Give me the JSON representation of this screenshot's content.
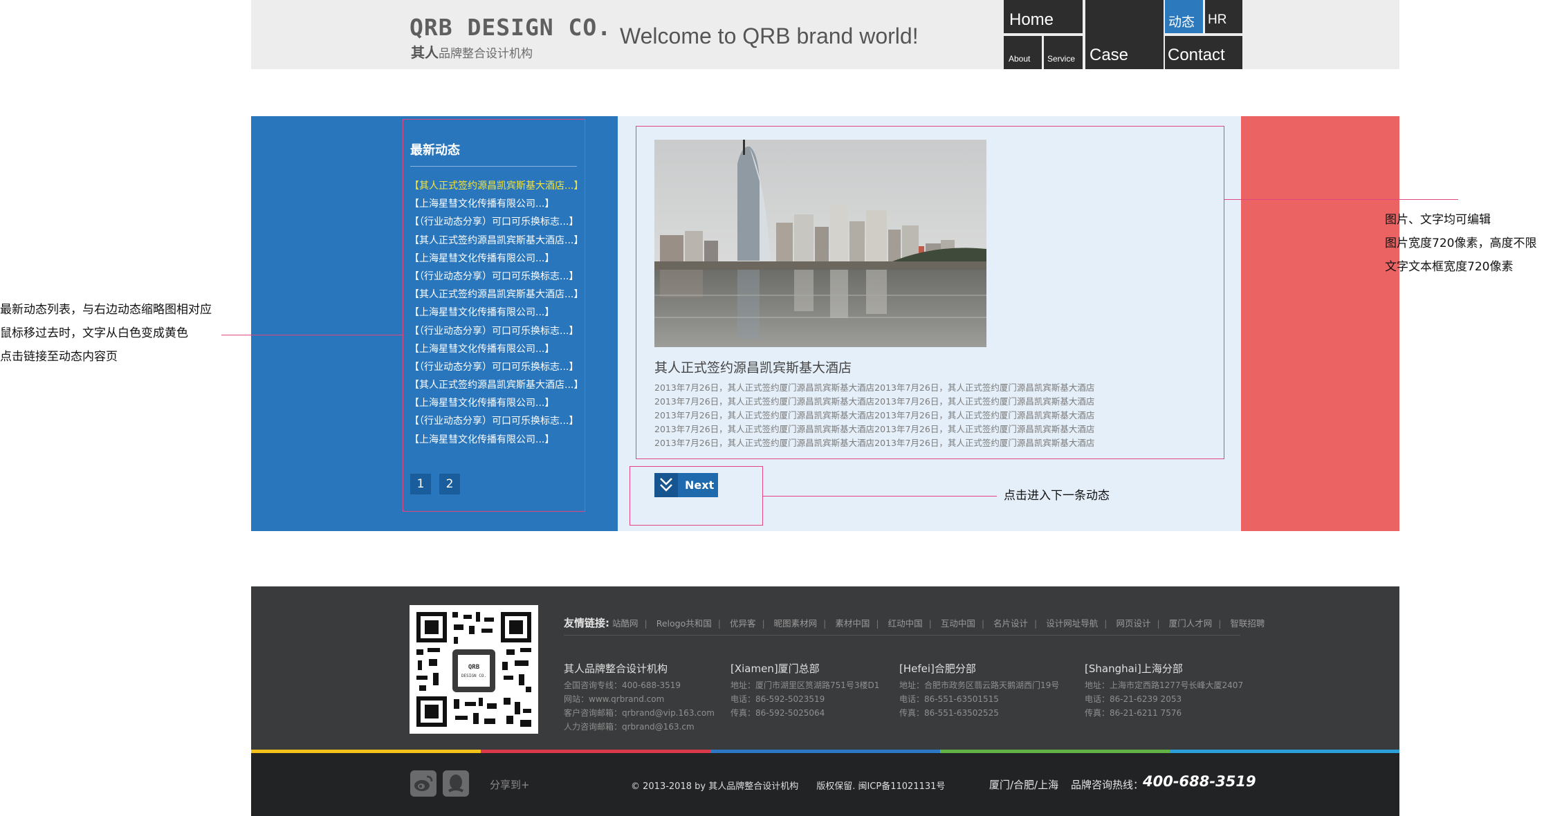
{
  "header": {
    "logo_title": "QRB DESIGN CO.",
    "logo_brand": "其人",
    "logo_sub": "品牌整合设计机构",
    "welcome": "Welcome to QRB brand world!",
    "nav": {
      "home": "Home",
      "about": "About",
      "service": "Service",
      "case": "Case",
      "news": "动态",
      "hr": "HR",
      "contact": "Contact"
    },
    "active_nav": "动态",
    "accent_color": "#2c79be"
  },
  "news_panel": {
    "title": "最新动态",
    "items": [
      "【其人正式签约源昌凯宾斯基大酒店...】",
      "【上海星彗文化传播有限公司...】",
      "【（行业动态分享）可口可乐换标志...】",
      "【其人正式签约源昌凯宾斯基大酒店...】",
      "【上海星彗文化传播有限公司...】",
      "【（行业动态分享）可口可乐换标志...】",
      "【其人正式签约源昌凯宾斯基大酒店...】",
      "【上海星彗文化传播有限公司...】",
      "【（行业动态分享）可口可乐换标志...】",
      "【上海星彗文化传播有限公司...】",
      "【（行业动态分享）可口可乐换标志...】",
      "【其人正式签约源昌凯宾斯基大酒店...】",
      "【上海星彗文化传播有限公司...】",
      "【（行业动态分享）可口可乐换标志...】",
      "【上海星彗文化传播有限公司...】"
    ],
    "highlight_color": "#f5e43c",
    "pages": [
      "1",
      "2"
    ]
  },
  "article": {
    "title": "其人正式签约源昌凯宾斯基大酒店",
    "lines": [
      "2013年7月26日，其人正式签约厦门源昌凯宾斯基大酒店2013年7月26日，其人正式签约厦门源昌凯宾斯基大酒店",
      "2013年7月26日，其人正式签约厦门源昌凯宾斯基大酒店2013年7月26日，其人正式签约厦门源昌凯宾斯基大酒店",
      "2013年7月26日，其人正式签约厦门源昌凯宾斯基大酒店2013年7月26日，其人正式签约厦门源昌凯宾斯基大酒店",
      "2013年7月26日，其人正式签约厦门源昌凯宾斯基大酒店2013年7月26日，其人正式签约厦门源昌凯宾斯基大酒店",
      "2013年7月26日，其人正式签约厦门源昌凯宾斯基大酒店2013年7月26日，其人正式签约厦门源昌凯宾斯基大酒店"
    ],
    "next_label": "Next"
  },
  "annotations": {
    "left": [
      "最新动态列表，与右边动态缩略图相对应",
      "鼠标移过去时，文字从白色变成黄色",
      "点击链接至动态内容页"
    ],
    "right": [
      "图片、文字均可编辑",
      "图片宽度720像素，高度不限",
      "文字文本框宽度720像素"
    ],
    "next": "点击进入下一条动态"
  },
  "footer": {
    "links_label": "友情链接:",
    "links": [
      "站酷网",
      "Relogo共和国",
      "优异客",
      "昵图素材网",
      "素材中国",
      "红动中国",
      "互动中国",
      "名片设计",
      "设计网址导航",
      "网页设计",
      "厦门人才网",
      "智联招聘"
    ],
    "offices": [
      {
        "name": "其人品牌整合设计机构",
        "lines": [
          "全国咨询专线：400-688-3519",
          "网站：www.qrbrand.com",
          "客户咨询邮箱：qrbrand@vip.163.com",
          "人力咨询邮箱：qrbrand@163.cm"
        ]
      },
      {
        "name": "[Xiamen]厦门总部",
        "lines": [
          "地址：厦门市湖里区筼湖路751号3楼D1",
          "电话：86-592-5023519",
          "传真：86-592-5025064"
        ]
      },
      {
        "name": "[Hefei]合肥分部",
        "lines": [
          "地址：合肥市政务区翡云路天鹅湖西门19号",
          "电话：86-551-63501515",
          "传真：86-551-63502525"
        ]
      },
      {
        "name": "[Shanghai]上海分部",
        "lines": [
          "地址：上海市定西路1277号长峰大厦2407",
          "电话：86-21-6239 2053",
          "传真：86-21-6211 7576"
        ]
      }
    ],
    "stripe_colors": [
      "#f3c21b",
      "#d83a4b",
      "#2d78c4",
      "#62b246",
      "#2d9fd8"
    ],
    "share_label": "分享到+",
    "copyright": "© 2013-2018 by 其人品牌整合设计机构　　版权保留. 闽ICP备11021131号",
    "cities": "厦门/合肥/上海",
    "hotline_label": "品牌咨询热线：",
    "hotline": "400-688-3519"
  }
}
